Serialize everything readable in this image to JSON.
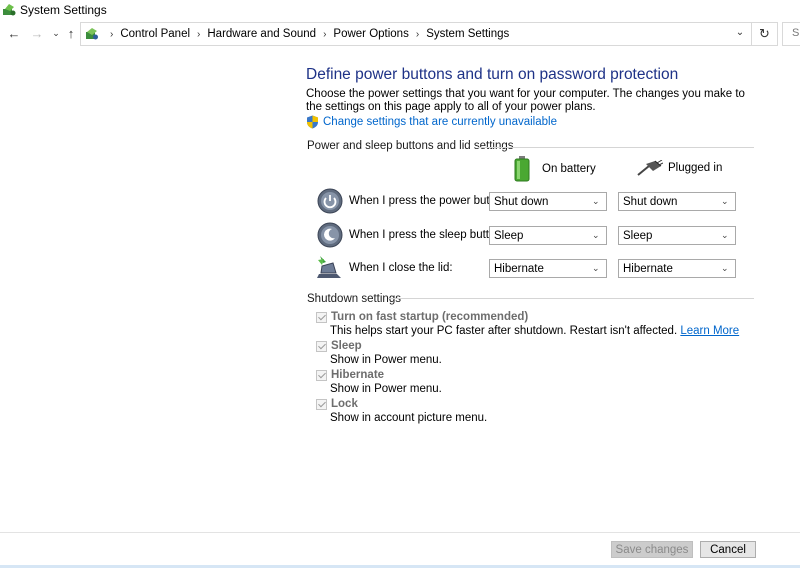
{
  "window": {
    "title": "System Settings"
  },
  "nav": {
    "back_icon": "arrow-left-icon",
    "forward_icon": "arrow-right-icon",
    "up_icon": "arrow-up-icon",
    "breadcrumbs": [
      "Control Panel",
      "Hardware and Sound",
      "Power Options",
      "System Settings"
    ],
    "search_placeholder": "S"
  },
  "page": {
    "title": "Define power buttons and turn on password protection",
    "description": "Choose the power settings that you want for your computer. The changes you make to the settings on this page apply to all of your power plans.",
    "change_link": "Change settings that are currently unavailable"
  },
  "power_section": {
    "label": "Power and sleep buttons and lid settings",
    "columns": {
      "battery": "On battery",
      "plugged": "Plugged in"
    },
    "rows": [
      {
        "label": "When I press the power button:",
        "battery": "Shut down",
        "plugged": "Shut down",
        "icon": "power-button-icon"
      },
      {
        "label": "When I press the sleep button:",
        "battery": "Sleep",
        "plugged": "Sleep",
        "icon": "sleep-button-icon"
      },
      {
        "label": "When I close the lid:",
        "battery": "Hibernate",
        "plugged": "Hibernate",
        "icon": "laptop-lid-icon"
      }
    ]
  },
  "shutdown_section": {
    "label": "Shutdown settings",
    "items": [
      {
        "label": "Turn on fast startup (recommended)",
        "desc": "This helps start your PC faster after shutdown. Restart isn't affected.",
        "link": "Learn More",
        "checked": true
      },
      {
        "label": "Sleep",
        "desc": "Show in Power menu.",
        "checked": true
      },
      {
        "label": "Hibernate",
        "desc": "Show in Power menu.",
        "checked": true
      },
      {
        "label": "Lock",
        "desc": "Show in account picture menu.",
        "checked": true
      }
    ]
  },
  "footer": {
    "save_label": "Save changes",
    "cancel_label": "Cancel"
  },
  "colors": {
    "title_blue": "#1e3287",
    "link_blue": "#0066cc",
    "disabled_text": "#6d6d6d"
  }
}
